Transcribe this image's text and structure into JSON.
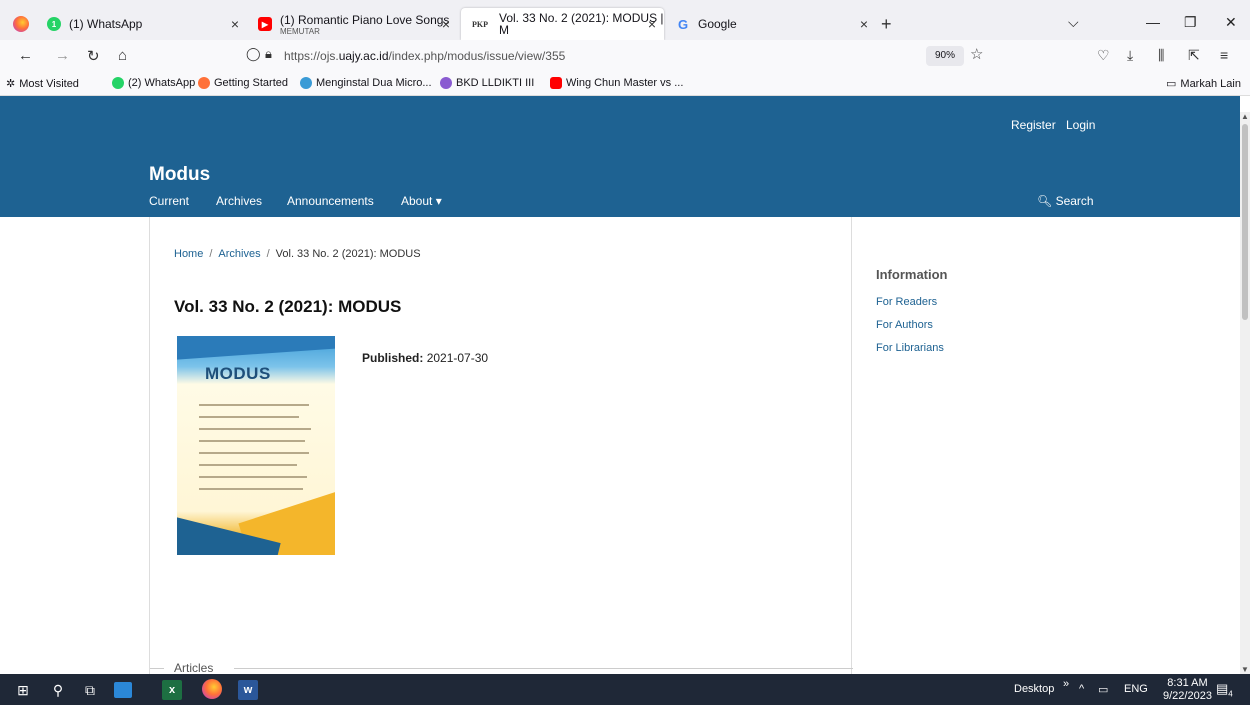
{
  "browser": {
    "tabs": [
      {
        "title": "(1) WhatsApp",
        "icon": "whatsapp-icon"
      },
      {
        "title": "(1) Romantic Piano Love Songs",
        "subtitle": "MEMUTAR",
        "icon": "youtube-icon"
      },
      {
        "title": "Vol. 33 No. 2 (2021): MODUS | M",
        "icon": "pkp-icon",
        "icon_text": "PKP",
        "active": true
      },
      {
        "title": "Google",
        "icon": "google-icon",
        "icon_text": "G"
      }
    ],
    "url_prefix": "https://ojs.",
    "url_host": "uajy.ac.id",
    "url_path": "/index.php/modus/issue/view/355",
    "zoom": "90%",
    "bookmarks": [
      {
        "label": "Most Visited",
        "icon": "gear-icon"
      },
      {
        "label": "(2) WhatsApp",
        "icon": "whatsapp-icon"
      },
      {
        "label": "Getting Started",
        "icon": "firefox-icon"
      },
      {
        "label": "Menginstal Dua Micro...",
        "icon": "globe-icon"
      },
      {
        "label": "BKD LLDIKTI III",
        "icon": "bkd-icon"
      },
      {
        "label": "Wing Chun Master vs ...",
        "icon": "youtube-icon"
      }
    ],
    "other_bookmarks": "Markah Lain"
  },
  "site": {
    "user_nav": {
      "register": "Register",
      "login": "Login"
    },
    "name": "Modus",
    "nav": {
      "current": "Current",
      "archives": "Archives",
      "announcements": "Announcements",
      "about": "About ▾"
    },
    "search": "Search"
  },
  "breadcrumb": {
    "home": "Home",
    "archives": "Archives",
    "current": "Vol. 33 No. 2 (2021): MODUS"
  },
  "issue": {
    "title": "Vol. 33 No. 2 (2021): MODUS",
    "cover_logo": "MODUS",
    "published_label": "Published:",
    "published_date": "2021-07-30",
    "section": "Articles"
  },
  "sidebar": {
    "title": "Information",
    "links": [
      "For Readers",
      "For Authors",
      "For Librarians"
    ]
  },
  "taskbar": {
    "desktop_label": "Desktop",
    "lang": "ENG",
    "time": "8:31 AM",
    "date": "9/22/2023",
    "notifications": "4"
  },
  "colors": {
    "header": "#1e6292",
    "link": "#1e6292",
    "taskbar": "#1f2837"
  }
}
